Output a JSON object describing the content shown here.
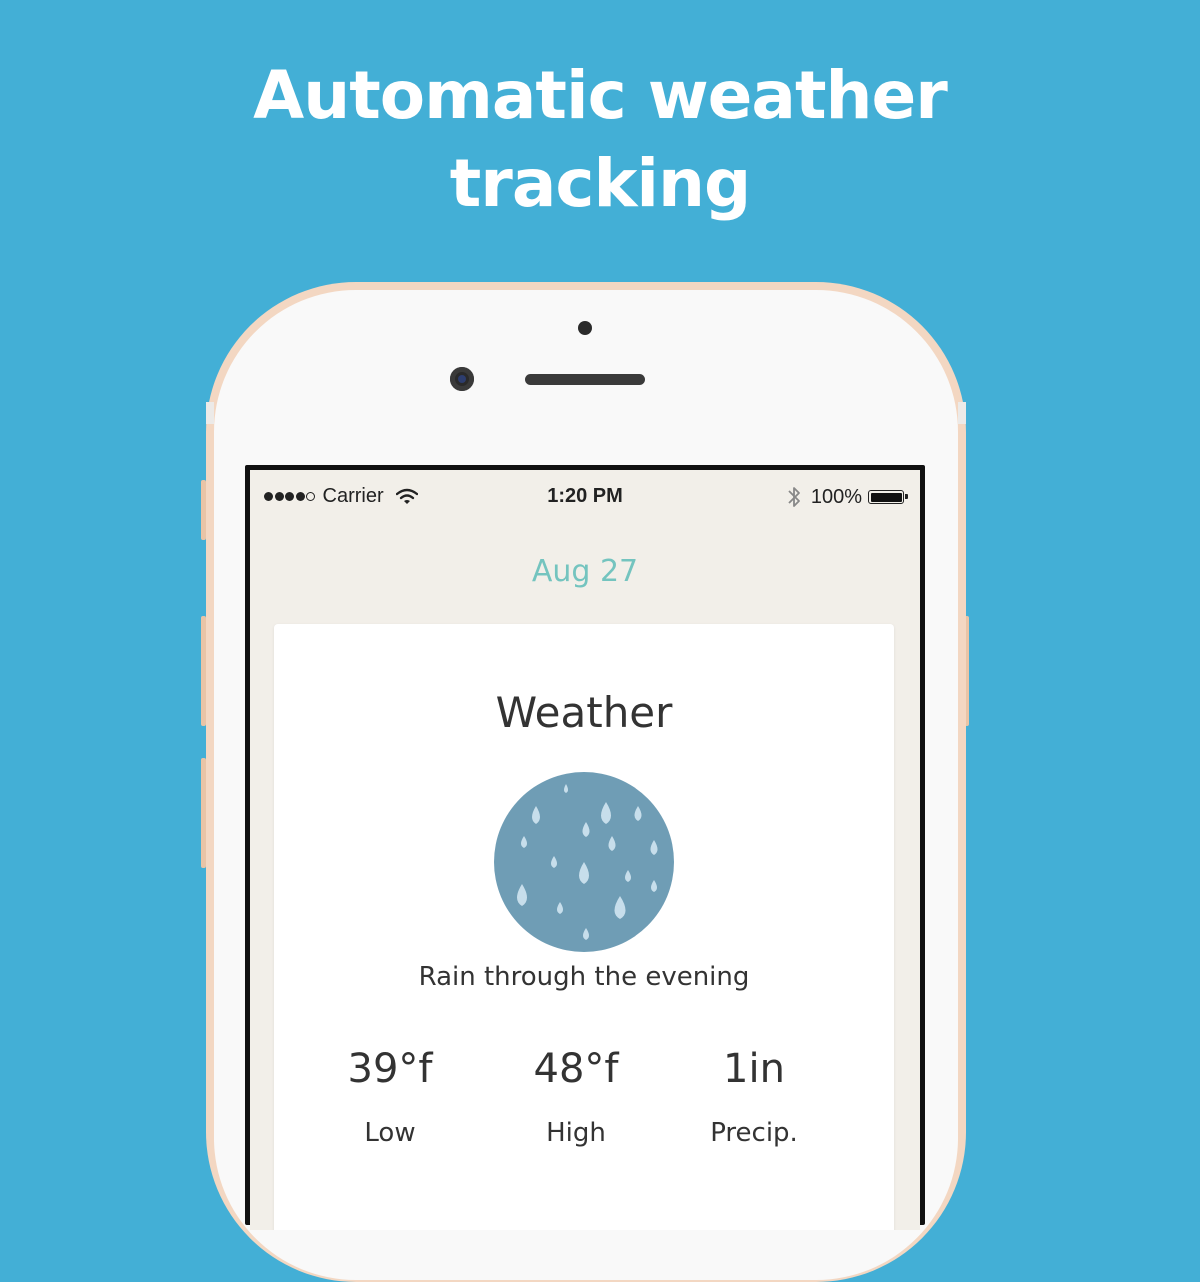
{
  "headline": {
    "line1": "Automatic weather",
    "line2": "tracking"
  },
  "status_bar": {
    "carrier": "Carrier",
    "time": "1:20 PM",
    "battery": "100%",
    "signal_bars": 4,
    "signal_max": 5
  },
  "screen": {
    "date": "Aug 27",
    "card": {
      "title": "Weather",
      "icon": "rain-icon",
      "summary": "Rain through the evening",
      "stats": [
        {
          "value": "39°f",
          "label": "Low"
        },
        {
          "value": "48°f",
          "label": "High"
        },
        {
          "value": "1in",
          "label": "Precip."
        }
      ]
    }
  },
  "colors": {
    "background": "#43afd6",
    "accent_date": "#74c4bf",
    "rain_circle": "#6f9db5",
    "rain_drop": "#c7deeb"
  }
}
